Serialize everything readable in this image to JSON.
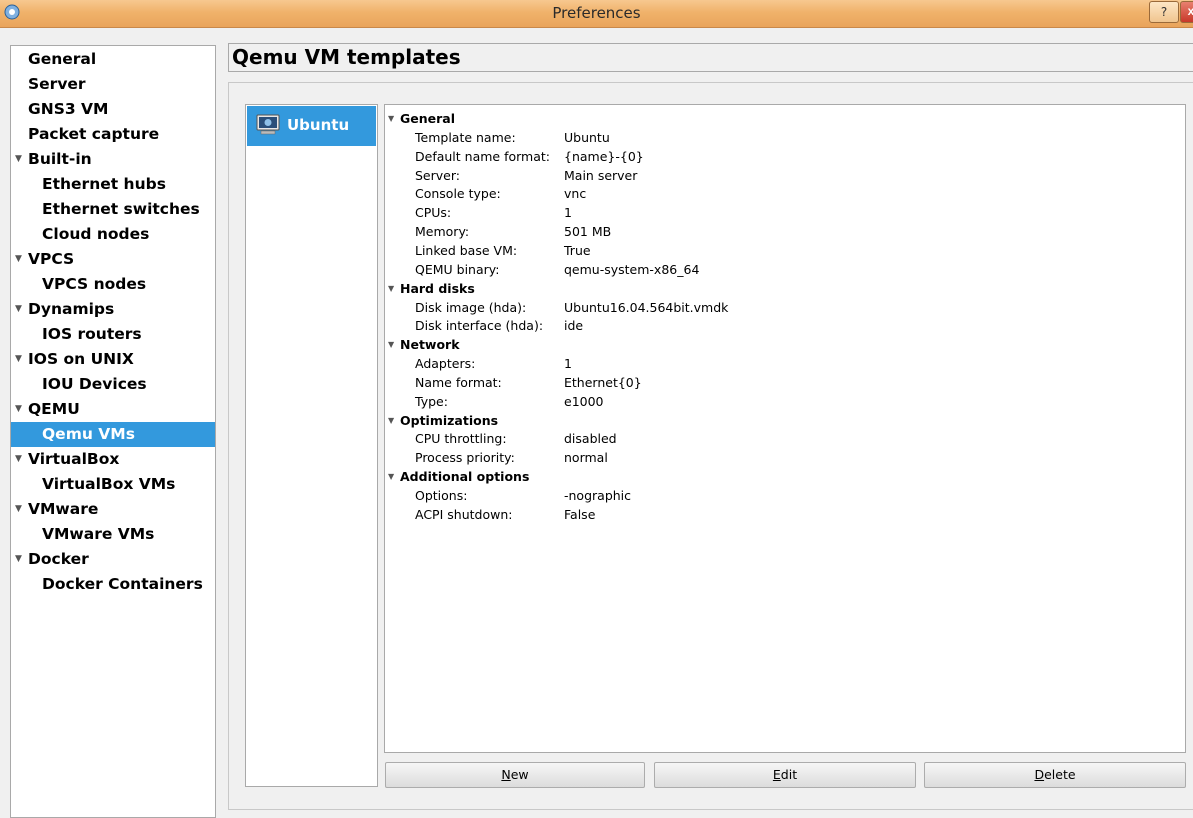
{
  "window": {
    "title": "Preferences",
    "help_label": "?",
    "close_label": "x"
  },
  "nav": [
    {
      "label": "General",
      "level": 0,
      "expandable": false,
      "selected": false
    },
    {
      "label": "Server",
      "level": 0,
      "expandable": false,
      "selected": false
    },
    {
      "label": "GNS3 VM",
      "level": 0,
      "expandable": false,
      "selected": false
    },
    {
      "label": "Packet capture",
      "level": 0,
      "expandable": false,
      "selected": false
    },
    {
      "label": "Built-in",
      "level": 0,
      "expandable": true,
      "selected": false
    },
    {
      "label": "Ethernet hubs",
      "level": 1,
      "expandable": false,
      "selected": false
    },
    {
      "label": "Ethernet switches",
      "level": 1,
      "expandable": false,
      "selected": false
    },
    {
      "label": "Cloud nodes",
      "level": 1,
      "expandable": false,
      "selected": false
    },
    {
      "label": "VPCS",
      "level": 0,
      "expandable": true,
      "selected": false
    },
    {
      "label": "VPCS nodes",
      "level": 1,
      "expandable": false,
      "selected": false
    },
    {
      "label": "Dynamips",
      "level": 0,
      "expandable": true,
      "selected": false
    },
    {
      "label": "IOS routers",
      "level": 1,
      "expandable": false,
      "selected": false
    },
    {
      "label": "IOS on UNIX",
      "level": 0,
      "expandable": true,
      "selected": false
    },
    {
      "label": "IOU Devices",
      "level": 1,
      "expandable": false,
      "selected": false
    },
    {
      "label": "QEMU",
      "level": 0,
      "expandable": true,
      "selected": false
    },
    {
      "label": "Qemu VMs",
      "level": 1,
      "expandable": false,
      "selected": true
    },
    {
      "label": "VirtualBox",
      "level": 0,
      "expandable": true,
      "selected": false
    },
    {
      "label": "VirtualBox VMs",
      "level": 1,
      "expandable": false,
      "selected": false
    },
    {
      "label": "VMware",
      "level": 0,
      "expandable": true,
      "selected": false
    },
    {
      "label": "VMware VMs",
      "level": 1,
      "expandable": false,
      "selected": false
    },
    {
      "label": "Docker",
      "level": 0,
      "expandable": true,
      "selected": false
    },
    {
      "label": "Docker Containers",
      "level": 1,
      "expandable": false,
      "selected": false
    }
  ],
  "page": {
    "title": "Qemu VM templates"
  },
  "templates": [
    {
      "name": "Ubuntu",
      "icon": "vm-icon",
      "selected": true
    }
  ],
  "properties": [
    {
      "section": "General",
      "rows": [
        {
          "key": "Template name:",
          "value": "Ubuntu"
        },
        {
          "key": "Default name format:",
          "value": "{name}-{0}"
        },
        {
          "key": "Server:",
          "value": "Main server"
        },
        {
          "key": "Console type:",
          "value": "vnc"
        },
        {
          "key": "CPUs:",
          "value": "1"
        },
        {
          "key": "Memory:",
          "value": "501 MB"
        },
        {
          "key": "Linked base VM:",
          "value": "True"
        },
        {
          "key": "QEMU binary:",
          "value": "qemu-system-x86_64"
        }
      ]
    },
    {
      "section": "Hard disks",
      "rows": [
        {
          "key": "Disk image (hda):",
          "value": "Ubuntu16.04.564bit.vmdk"
        },
        {
          "key": "Disk interface (hda):",
          "value": "ide"
        }
      ]
    },
    {
      "section": "Network",
      "rows": [
        {
          "key": "Adapters:",
          "value": "1"
        },
        {
          "key": "Name format:",
          "value": "Ethernet{0}"
        },
        {
          "key": "Type:",
          "value": "e1000"
        }
      ]
    },
    {
      "section": "Optimizations",
      "rows": [
        {
          "key": "CPU throttling:",
          "value": "disabled"
        },
        {
          "key": "Process priority:",
          "value": "normal"
        }
      ]
    },
    {
      "section": "Additional options",
      "rows": [
        {
          "key": "Options:",
          "value": "-nographic"
        },
        {
          "key": "ACPI shutdown:",
          "value": "False"
        }
      ]
    }
  ],
  "buttons": [
    {
      "label": "New",
      "mnemonic": "N"
    },
    {
      "label": "Edit",
      "mnemonic": "E"
    },
    {
      "label": "Delete",
      "mnemonic": "D"
    }
  ],
  "colors": {
    "selection": "#3399dd",
    "titlebar": "#f0b26b"
  }
}
